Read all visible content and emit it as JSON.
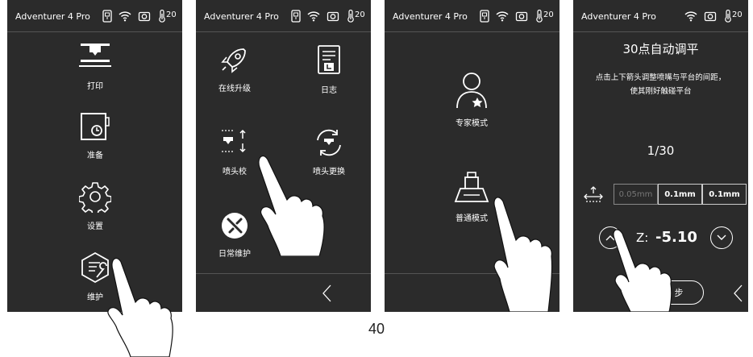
{
  "screens": [
    {
      "device_title": "Adventurer 4 Pro",
      "temperature": "20",
      "menu": [
        "打印",
        "准备",
        "设置",
        "维护"
      ]
    },
    {
      "device_title": "Adventurer 4 Pro",
      "temperature": "20",
      "menu": [
        "在线升级",
        "日志",
        "喷头校",
        "喷头更换",
        "日常维护"
      ]
    },
    {
      "device_title": "Adventurer 4 Pro",
      "temperature": "20",
      "menu": [
        "专家模式",
        "普通模式"
      ]
    },
    {
      "device_title": "Adventurer 4 Pro",
      "temperature": "20",
      "title": "30点自动调平",
      "description_line1": "点击上下箭头调整喷嘴与平台的间距，",
      "description_line2": "使其刚好触碰平台",
      "progress": "1/30",
      "steps": [
        "0.05mm",
        "0.1mm",
        "0.1mm"
      ],
      "z_label": "Z:",
      "z_value": "-5.10",
      "complete_label": "步"
    }
  ],
  "page_number": "40"
}
